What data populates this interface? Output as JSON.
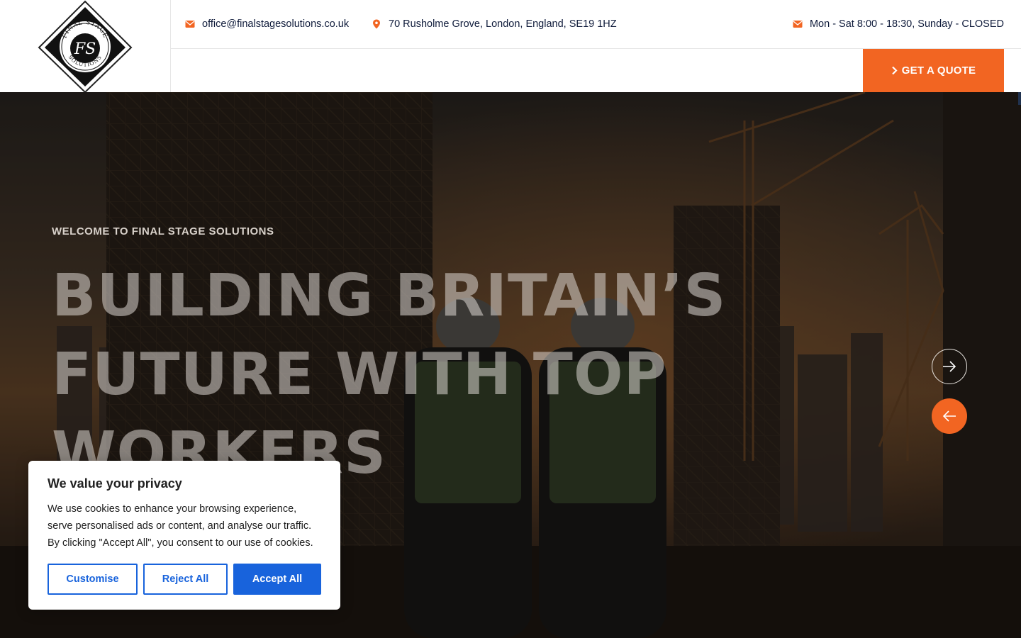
{
  "brand": {
    "logo_text_top": "FINAL STAGE",
    "logo_text_bottom": "SOLUTIONS",
    "logo_monogram": "FS"
  },
  "topbar": {
    "email": "office@finalstagesolutions.co.uk",
    "address": "70 Rusholme Grove, London, England, SE19 1HZ",
    "hours": "Mon - Sat 8:00 - 18:30, Sunday - CLOSED",
    "icons": {
      "email": "envelope-icon",
      "address": "map-pin-icon",
      "hours": "envelope-icon"
    }
  },
  "header": {
    "quote_button": "GET A QUOTE"
  },
  "hero": {
    "eyebrow": "WELCOME TO FINAL STAGE SOLUTIONS",
    "headline_lines": [
      "BUILDING BRITAIN’S",
      "FUTURE WITH TOP",
      "WORKERS"
    ],
    "next_icon": "arrow-right-icon",
    "prev_icon": "arrow-left-icon"
  },
  "cookie_banner": {
    "title": "We value your privacy",
    "text": "We use cookies to enhance your browsing experience, serve personalised ads or content, and analyse our traffic. By clicking \"Accept All\", you consent to our use of cookies.",
    "customise": "Customise",
    "reject": "Reject All",
    "accept": "Accept All"
  },
  "colors": {
    "accent": "#f26522",
    "navy": "#0e1a3a",
    "cookie_blue": "#1863dc"
  }
}
